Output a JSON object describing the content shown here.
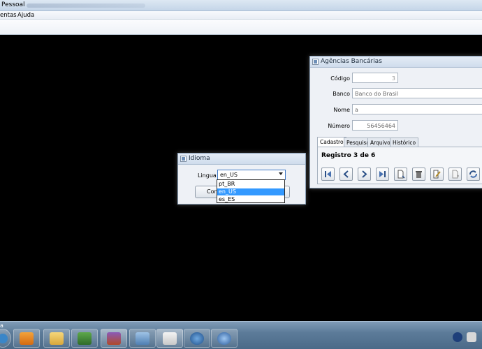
{
  "window": {
    "title": "Pessoal",
    "menu": [
      "entas",
      "Ajuda"
    ]
  },
  "agencias": {
    "title": "Agências Bancárias",
    "fields": [
      {
        "label": "Código",
        "value": "3"
      },
      {
        "label": "Banco",
        "value": "Banco do Brasil"
      },
      {
        "label": "Nome",
        "value": "a"
      },
      {
        "label": "Número",
        "value": "56456464"
      }
    ],
    "tabs": [
      "Cadastro",
      "Pesquisa",
      "Arquivo",
      "Histórico"
    ],
    "active_tab": "Cadastro",
    "record_text": "Registro 3 de 6",
    "toolbar": [
      "first-icon",
      "previous-icon",
      "next-icon",
      "last-icon",
      "new-icon",
      "delete-icon",
      "edit-icon",
      "save-icon",
      "refresh-icon"
    ]
  },
  "idioma": {
    "title": "Idioma",
    "label": "Lingua",
    "selected": "en_US",
    "confirm_label": "Con",
    "options": [
      "pt_BR",
      "en_US",
      "es_ES"
    ],
    "highlighted_option": "en_US"
  },
  "taskbar": {
    "text": "a"
  },
  "colors": {
    "desktop": "#000000",
    "selection": "#3399ff",
    "taskbar": "#5c7b99"
  }
}
